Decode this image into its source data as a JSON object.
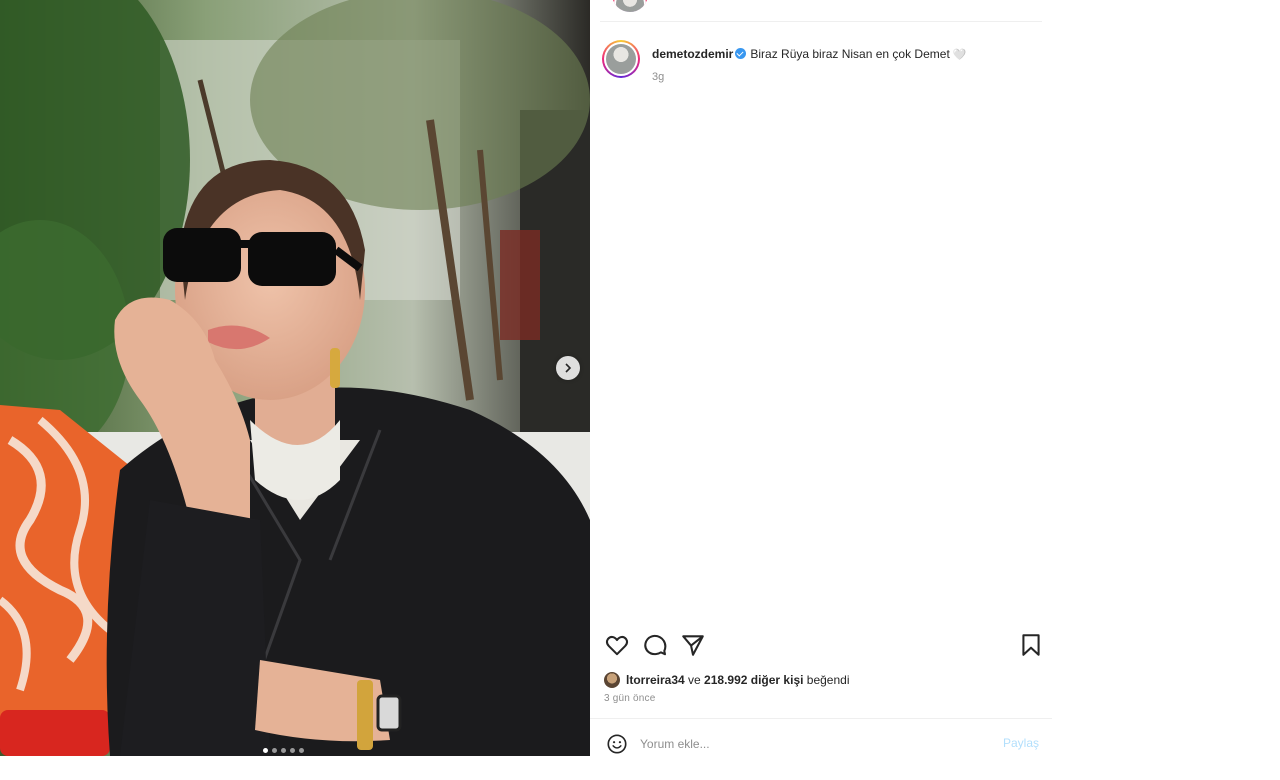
{
  "post": {
    "username": "demetozdemir",
    "caption": "Biraz Rüya biraz Nisan en çok Demet",
    "caption_emoji": "🤍",
    "time_short": "3g",
    "liked_by_user": "ltorreira34",
    "likes_connector": " ve ",
    "likes_others": "218.992 diğer kişi",
    "likes_suffix": " beğendi",
    "time_ago": "3 gün önce"
  },
  "carousel": {
    "total_slides": 5,
    "active_slide": 1
  },
  "comment": {
    "placeholder": "Yorum ekle...",
    "post_label": "Paylaş"
  },
  "icons": {
    "like": "heart-icon",
    "comment": "comment-icon",
    "share": "send-icon",
    "save": "bookmark-icon",
    "emoji": "smiley-icon",
    "next": "chevron-right-icon",
    "verified": "verified-badge-icon"
  },
  "colors": {
    "verified_blue": "#3897f0",
    "post_button_disabled": "#b2dffc",
    "muted_text": "#8e8e8e"
  }
}
